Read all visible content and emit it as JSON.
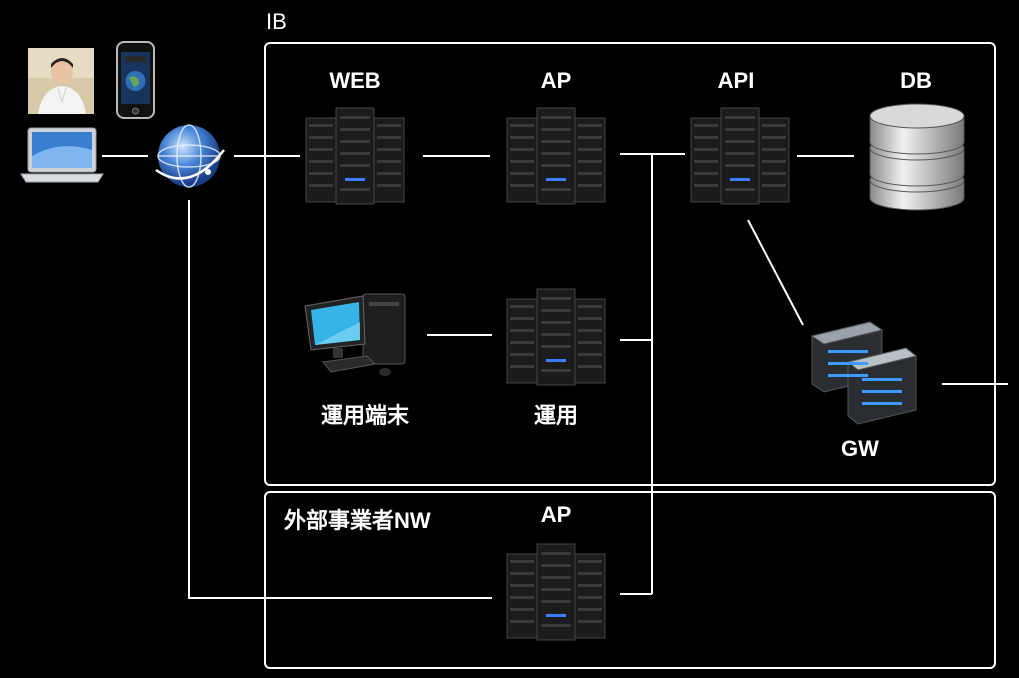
{
  "zones": {
    "ib": "IB",
    "external": "外部事業者NW"
  },
  "nodes": {
    "web": "WEB",
    "ap": "AP",
    "api": "API",
    "db": "DB",
    "ops_terminal": "運用端末",
    "ops_server": "運用",
    "gw": "GW",
    "external_ap": "AP"
  },
  "icons": {
    "user_photo": "person-photo-icon",
    "phone": "smartphone-icon",
    "laptop": "laptop-icon",
    "internet": "globe-icon",
    "server_rack": "server-rack-icon",
    "database": "database-icon",
    "desktop": "desktop-pc-icon",
    "gateway": "gateway-server-icon"
  },
  "colors": {
    "background": "#000000",
    "lines": "#ffffff",
    "rack_body": "#1b1b1b",
    "rack_led": "#3d7bff",
    "db_silver": "#c9c9c9"
  }
}
